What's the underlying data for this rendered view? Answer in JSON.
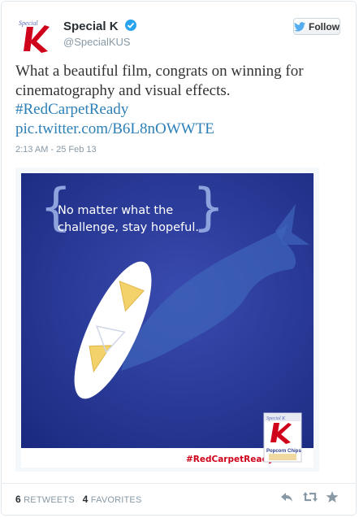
{
  "profile": {
    "name": "Special K",
    "handle": "@SpecialKUS",
    "avatar_text": "Special K"
  },
  "follow": {
    "label": "Follow"
  },
  "tweet": {
    "line1": "What a beautiful film, congrats on winning for",
    "line2": "cinematography and visual effects.",
    "hashtag": "#RedCarpetReady",
    "link": "pic.twitter.com/B6L8nOWWTE"
  },
  "meta": {
    "timestamp": "2:13 AM - 25 Feb 13"
  },
  "image": {
    "quote_line1": "No matter what the",
    "quote_line2": "challenge, stay hopeful.",
    "hashtag": "#RedCarpetReady",
    "box_brand": "Special K",
    "box_product": "Popcorn Chips"
  },
  "stats": {
    "retweets_count": "6",
    "retweets_label": "RETWEETS",
    "favorites_count": "4",
    "favorites_label": "FAVORITES"
  },
  "colors": {
    "link": "#2c7fb7",
    "twitter_blue": "#55acee",
    "verified": "#2aa3ef",
    "brand_red": "#d0021b",
    "image_bg": "#1f2f87"
  },
  "icons": [
    "twitter-bird-icon",
    "verified-icon",
    "reply-icon",
    "retweet-icon",
    "favorite-icon"
  ]
}
